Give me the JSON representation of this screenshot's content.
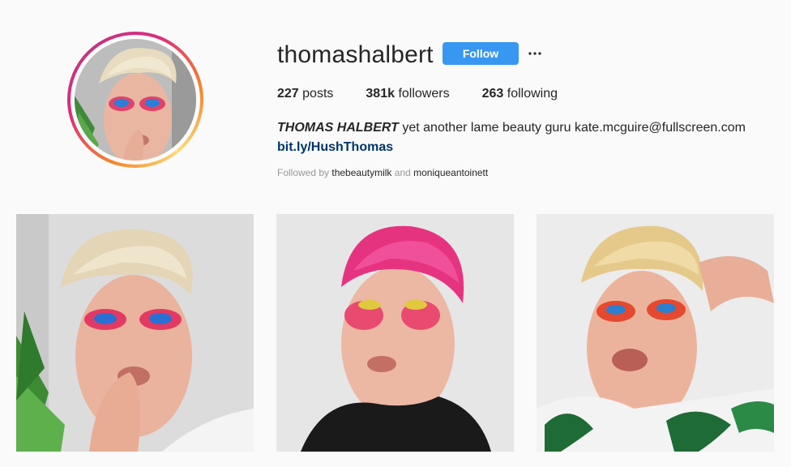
{
  "profile": {
    "username": "thomashalbert",
    "follow_label": "Follow",
    "stats": {
      "posts_count": "227",
      "posts_label": "posts",
      "followers_count": "381k",
      "followers_label": "followers",
      "following_count": "263",
      "following_label": "following"
    },
    "bio": {
      "full_name": "THOMAS HALBERT",
      "text": " yet another lame beauty guru kate.mcguire@fullscreen.com",
      "link": "bit.ly/HushThomas"
    },
    "followed_by": {
      "prefix": "Followed by",
      "account_1": "thebeautymilk",
      "joiner": "and",
      "account_2": "moniqueantoinett"
    }
  },
  "icons": {
    "more": "more-horizontal-icon"
  },
  "colors": {
    "follow_button": "#3897f0",
    "link": "#003569",
    "background": "#fafafa"
  }
}
